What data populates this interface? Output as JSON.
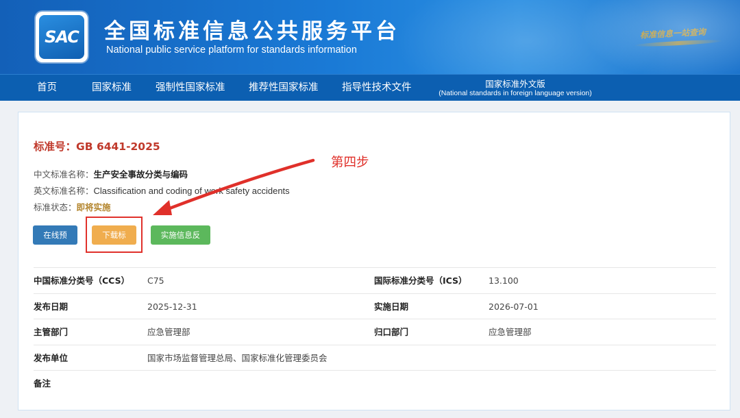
{
  "header": {
    "logo_text": "SAC",
    "title": "全国标准信息公共服务平台",
    "subtitle": "National public service platform  for standards information",
    "slogan": "标准信息一站查询"
  },
  "nav": {
    "items": [
      {
        "label": "首页"
      },
      {
        "label": "国家标准"
      },
      {
        "label": "强制性国家标准"
      },
      {
        "label": "推荐性国家标准"
      },
      {
        "label": "指导性技术文件"
      }
    ],
    "foreign": {
      "label": "国家标准外文版",
      "sublabel": "(National standards in foreign language version)"
    }
  },
  "standard": {
    "number_label": "标准号：",
    "number": "GB 6441-2025",
    "cn_name_label": "中文标准名称：",
    "cn_name": "生产安全事故分类与编码",
    "en_name_label": "英文标准名称：",
    "en_name": "Classification and coding of work safety accidents",
    "status_label": "标准状态：",
    "status": "即将实施"
  },
  "buttons": {
    "preview": "在线预览",
    "download": "下载标准",
    "feedback": "实施信息反馈"
  },
  "annotation": {
    "step_label": "第四步",
    "color": "#e0302a"
  },
  "details": {
    "ccs_label": "中国标准分类号（CCS）",
    "ccs_value": "C75",
    "ics_label": "国际标准分类号（ICS）",
    "ics_value": "13.100",
    "publish_date_label": "发布日期",
    "publish_date": "2025-12-31",
    "impl_date_label": "实施日期",
    "impl_date": "2026-07-01",
    "competent_dept_label": "主管部门",
    "competent_dept": "应急管理部",
    "central_dept_label": "归口部门",
    "central_dept": "应急管理部",
    "publisher_label": "发布单位",
    "publisher": "国家市场监督管理总局、国家标准化管理委员会",
    "remarks_label": "备注",
    "remarks": ""
  },
  "colors": {
    "nav_bg": "#0c5fb1",
    "std_no": "#c0392b",
    "btn_preview": "#337ab7",
    "btn_download": "#f0ad4e",
    "btn_feedback": "#5cb85c",
    "status": "#b4862e"
  }
}
